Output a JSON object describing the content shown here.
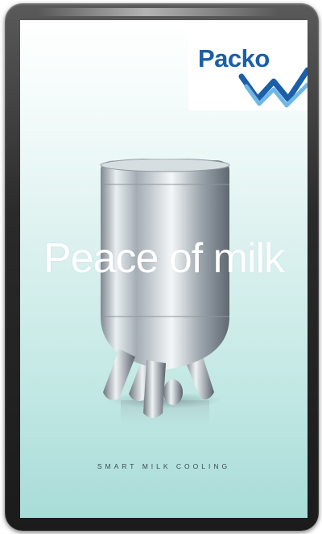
{
  "brand": {
    "name": "Packo",
    "color": "#1a5fa8",
    "mark_colors": [
      "#1a5fa8",
      "#6fb7e6"
    ]
  },
  "headline": "Peace of milk",
  "tagline": "SMART MILK COOLING",
  "image": {
    "subject_icon": "milk-cooling-tank-icon"
  },
  "colors": {
    "frame": "#1b1b1b",
    "background_top": "#ffffff",
    "background_bottom": "#a9dcd8"
  }
}
